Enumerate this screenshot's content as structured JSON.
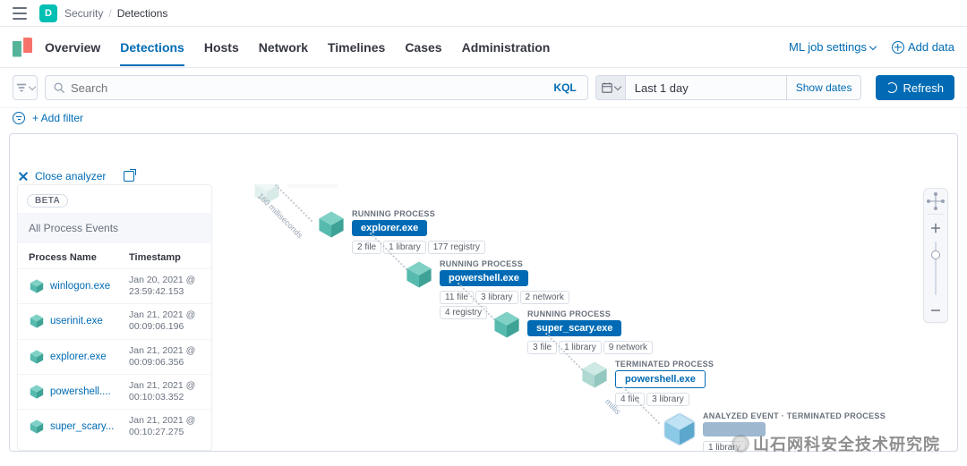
{
  "header": {
    "logo_letter": "D",
    "breadcrumb": [
      "Security",
      "Detections"
    ]
  },
  "nav": {
    "tabs": [
      "Overview",
      "Detections",
      "Hosts",
      "Network",
      "Timelines",
      "Cases",
      "Administration"
    ],
    "active_index": 1,
    "ml_link": "ML job settings",
    "add_data": "Add data"
  },
  "query": {
    "search_placeholder": "Search",
    "kql": "KQL",
    "date_range": "Last 1 day",
    "show_dates": "Show dates",
    "refresh": "Refresh",
    "add_filter": "+ Add filter"
  },
  "analyzer": {
    "close": "Close analyzer",
    "beta": "BETA",
    "panel_title": "All Process Events",
    "columns": {
      "name": "Process Name",
      "ts": "Timestamp"
    },
    "rows": [
      {
        "name": "winlogon.exe",
        "ts1": "Jan 20, 2021 @",
        "ts2": "23:59:42.153"
      },
      {
        "name": "userinit.exe",
        "ts1": "Jan 21, 2021 @",
        "ts2": "00:09:06.196"
      },
      {
        "name": "explorer.exe",
        "ts1": "Jan 21, 2021 @",
        "ts2": "00:09:06.356"
      },
      {
        "name": "powershell....",
        "ts1": "Jan 21, 2021 @",
        "ts2": "00:10:03.352"
      },
      {
        "name": "super_scary...",
        "ts1": "Jan 21, 2021 @",
        "ts2": "00:10:27.275"
      }
    ],
    "edge_labels": {
      "e0": "160 milliseconds",
      "e3": "millis"
    },
    "state_labels": {
      "running": "RUNNING PROCESS",
      "terminated": "TERMINATED PROCESS",
      "analyzed": "ANALYZED EVENT · TERMINATED PROCESS"
    },
    "nodes": [
      {
        "id": "partial_top",
        "state": "partial",
        "label": "",
        "stats": []
      },
      {
        "id": "explorer",
        "state": "running",
        "label": "explorer.exe",
        "stats": [
          "2 file",
          "1 library",
          "177 registry"
        ]
      },
      {
        "id": "powershell1",
        "state": "running",
        "label": "powershell.exe",
        "stats": [
          "11 file",
          "3 library",
          "2 network",
          "4 registry"
        ]
      },
      {
        "id": "super_scary",
        "state": "running",
        "label": "super_scary.exe",
        "stats": [
          "3 file",
          "1 library",
          "9 network"
        ]
      },
      {
        "id": "powershell2",
        "state": "terminated",
        "label": "powershell.exe",
        "stats": [
          "4 file",
          "3 library"
        ]
      },
      {
        "id": "analyzed",
        "state": "analyzed",
        "label": "",
        "stats": [
          "1 library"
        ]
      }
    ]
  },
  "watermark": "山石网科安全技术研究院"
}
